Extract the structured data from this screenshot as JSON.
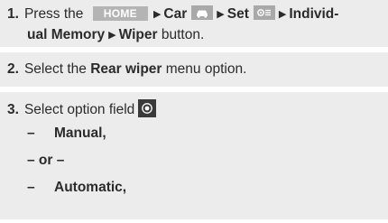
{
  "steps": [
    {
      "number": "1.",
      "text_press": "Press the",
      "home_label": "HOME",
      "car_label": "Car",
      "car_icon": "car-icon",
      "set_label": "Set",
      "set_icon": "settings-toggle-icon",
      "individ_part1": "Individ-",
      "individ_part2": "ual Memory",
      "wiper_label": "Wiper",
      "button_word": "button."
    },
    {
      "number": "2.",
      "text_select": "Select the",
      "rear_wiper_label": "Rear wiper",
      "text_menu": "menu option."
    },
    {
      "number": "3.",
      "text_select_option": "Select option field",
      "radio_icon": "radio-option-icon",
      "dash": "–",
      "manual_label": "Manual,",
      "or_label": "– or –",
      "automatic_label": "Automatic,"
    }
  ],
  "colors": {
    "step_background": "#ececec",
    "home_button": "#b4b4b4",
    "icon_box": "#a9a9a9",
    "radio_box": "#3a3a3a"
  }
}
